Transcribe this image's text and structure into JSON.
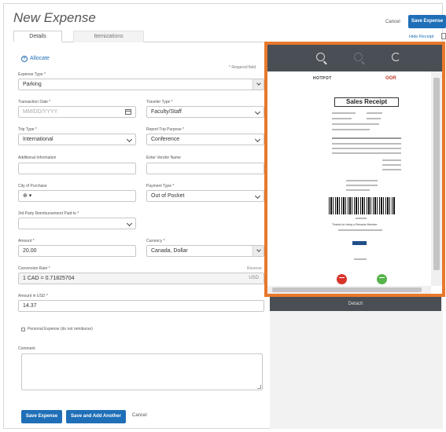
{
  "header": {
    "title": "New Expense",
    "cancel_label": "Cancel",
    "save_label": "Save Expense",
    "hide_receipt_label": "Hide Receipt"
  },
  "tabs": [
    {
      "label": "Details",
      "active": true
    },
    {
      "label": "Itemizations",
      "active": false
    }
  ],
  "form": {
    "allocate_label": "Allocate",
    "required_note": "* Required field",
    "expense_type": {
      "label": "Expense Type *",
      "value": "Parking"
    },
    "transaction_date": {
      "label": "Transaction Date *",
      "placeholder": "MM/DD/YYYY"
    },
    "traveler_type": {
      "label": "Traveler Type *",
      "value": "Faculty/Staff"
    },
    "trip_type": {
      "label": "Trip Type *",
      "value": "International"
    },
    "report_trip_purpose": {
      "label": "Report Trip Purpose *",
      "value": "Conference"
    },
    "additional_information": {
      "label": "Additional Information",
      "value": ""
    },
    "vendor_name": {
      "label": "Enter Vendor Name",
      "value": ""
    },
    "city_of_purchase": {
      "label": "City of Purchase",
      "value": "⊕ ▾"
    },
    "payment_type": {
      "label": "Payment Type *",
      "value": "Out of Pocket"
    },
    "third_party": {
      "label": "3rd Party Reimbursement Paid to *",
      "value": ""
    },
    "amount": {
      "label": "Amount *",
      "value": "20.00"
    },
    "currency": {
      "label": "Currency *",
      "value": "Canada, Dollar"
    },
    "conversion_rate": {
      "label": "Conversion Rate *",
      "value": "1 CAD = 0.71825704",
      "reverse_label": "Reverse",
      "unit": "USD"
    },
    "amount_usd": {
      "label": "Amount in USD *",
      "value": "14.37"
    },
    "personal_expense_label": "Personal Expense (do not reimburse)",
    "comment": {
      "label": "Comment",
      "value": ""
    }
  },
  "footer": {
    "save_label": "Save Expense",
    "save_add_label": "Save and Add Another",
    "cancel_label": "Cancel"
  },
  "receipt": {
    "logo_left": "HOTPOT",
    "logo_right": "OOR",
    "receipt_title": "Sales Receipt",
    "footer_note": "Thanks for being a Rewards Member",
    "detach_label": "Detach",
    "colors": {
      "highlight": "#e8782c",
      "toolbar": "#4a4f55",
      "accent": "#1f6fb8"
    }
  }
}
